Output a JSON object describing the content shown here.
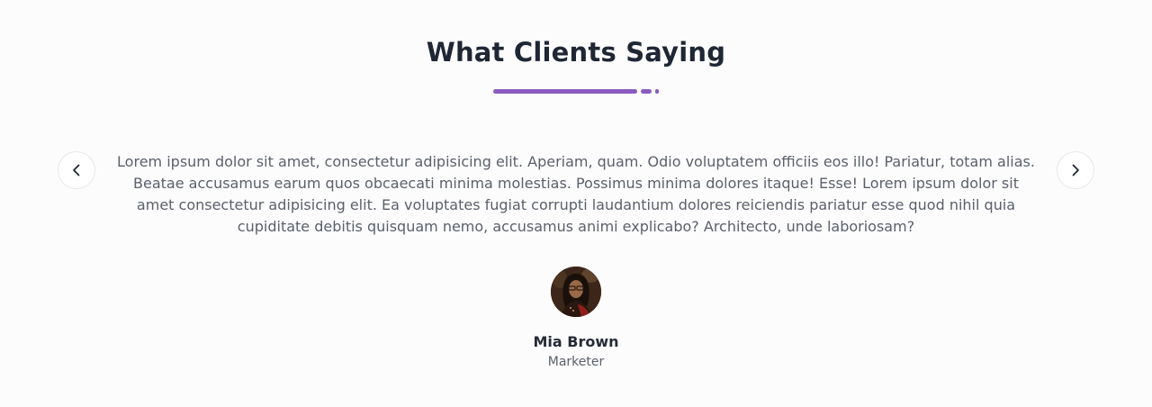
{
  "section": {
    "title": "What Clients Saying",
    "accent_color": "#8a5cc0"
  },
  "navigation": {
    "prev_icon": "chevron-left-icon",
    "next_icon": "chevron-right-icon"
  },
  "testimonial": {
    "quote": "Lorem ipsum dolor sit amet, consectetur adipisicing elit. Aperiam, quam. Odio voluptatem officiis eos illo! Pariatur, totam alias. Beatae accusamus earum quos obcaecati minima molestias. Possimus minima dolores itaque! Esse! Lorem ipsum dolor sit amet consectetur adipisicing elit. Ea voluptates fugiat corrupti laudantium dolores reiciendis pariatur esse quod nihil quia cupiditate debitis quisquam nemo, accusamus animi explicabo? Architecto, unde laboriosam?",
    "name": "Mia Brown",
    "role": "Marketer"
  }
}
